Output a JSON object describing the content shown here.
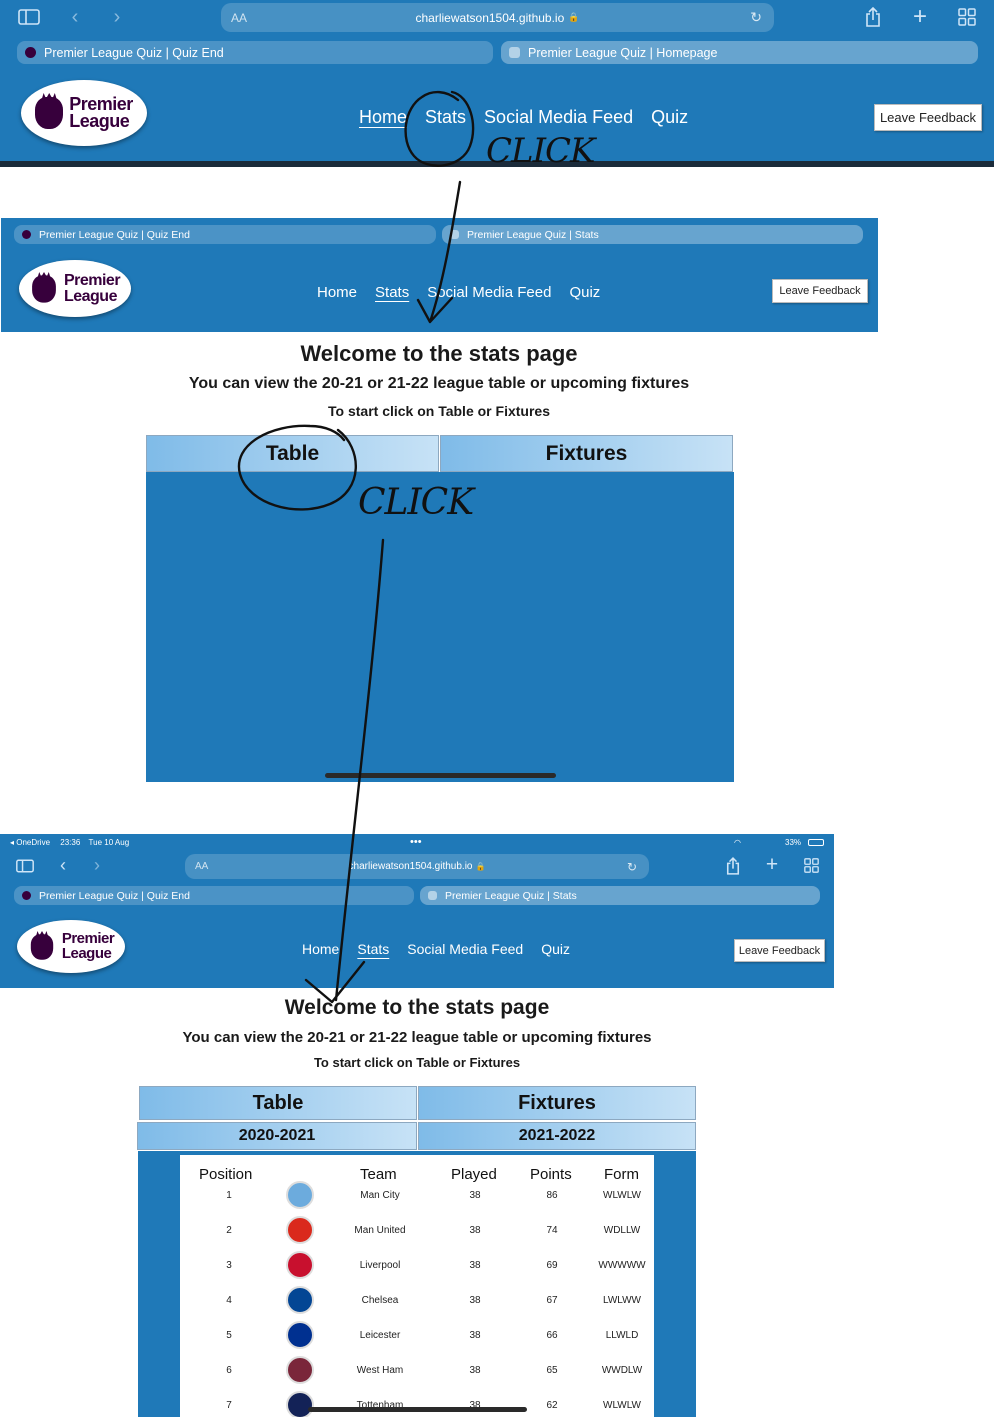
{
  "browser": {
    "url": "charliewatson1504.github.io",
    "aa": "AA",
    "lock": "🔒",
    "reload": "↻",
    "icons": [
      "sidebar-icon",
      "back-icon",
      "forward-icon",
      "share-icon",
      "new-tab-icon",
      "tabs-overview-icon"
    ],
    "status": {
      "app": "◂ OneDrive",
      "time": "23:36",
      "date": "Tue 10 Aug",
      "dots": "•••",
      "battery": "33%"
    }
  },
  "shot1": {
    "tabs": [
      "Premier League Quiz | Quiz End",
      "Premier League Quiz | Homepage"
    ]
  },
  "shot2": {
    "tabs": [
      "Premier League Quiz | Quiz End",
      "Premier League Quiz | Stats"
    ]
  },
  "shot3": {
    "tabs": [
      "Premier League Quiz | Quiz End",
      "Premier League Quiz | Stats"
    ]
  },
  "site": {
    "logo_line1": "Premier",
    "logo_line2": "League",
    "nav": [
      "Home",
      "Stats",
      "Social Media Feed",
      "Quiz"
    ],
    "feedback": "Leave Feedback",
    "welcome": "Welcome to the stats page",
    "subtitle": "You can view the 20-21 or 21-22 league table or upcoming fixtures",
    "instruction": "To start click on Table or Fixtures",
    "tab_table": "Table",
    "tab_fixtures": "Fixtures",
    "season_a": "2020-2021",
    "season_b": "2021-2022"
  },
  "annotations": {
    "click_1": "CLICK",
    "click_2": "CLICK"
  },
  "league_table": {
    "headers": [
      "Position",
      "Team",
      "Played",
      "Points",
      "Form"
    ],
    "rows": [
      {
        "pos": "1",
        "team": "Man City",
        "played": "38",
        "points": "86",
        "form": "WLWLW",
        "color": "#6cabdd"
      },
      {
        "pos": "2",
        "team": "Man United",
        "played": "38",
        "points": "74",
        "form": "WDLLW",
        "color": "#da291c"
      },
      {
        "pos": "3",
        "team": "Liverpool",
        "played": "38",
        "points": "69",
        "form": "WWWWW",
        "color": "#c8102e"
      },
      {
        "pos": "4",
        "team": "Chelsea",
        "played": "38",
        "points": "67",
        "form": "LWLWW",
        "color": "#034694"
      },
      {
        "pos": "5",
        "team": "Leicester",
        "played": "38",
        "points": "66",
        "form": "LLWLD",
        "color": "#003090"
      },
      {
        "pos": "6",
        "team": "West Ham",
        "played": "38",
        "points": "65",
        "form": "WWDLW",
        "color": "#7a263a"
      },
      {
        "pos": "7",
        "team": "Tottenham",
        "played": "38",
        "points": "62",
        "form": "WLWLW",
        "color": "#132257"
      }
    ]
  }
}
